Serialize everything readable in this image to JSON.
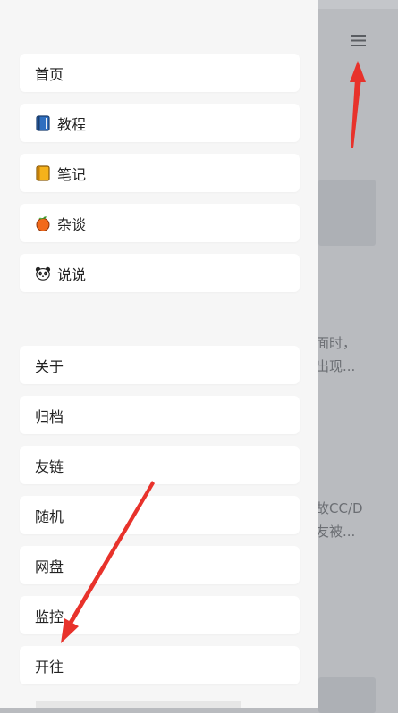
{
  "drawer": {
    "primary_items": [
      {
        "label": "首页",
        "icon": ""
      },
      {
        "label": "教程",
        "icon": "book-icon"
      },
      {
        "label": "笔记",
        "icon": "notebook-icon"
      },
      {
        "label": "杂谈",
        "icon": "tangerine-icon"
      },
      {
        "label": "说说",
        "icon": "panda-icon"
      }
    ],
    "secondary_items": [
      {
        "label": "关于"
      },
      {
        "label": "归档"
      },
      {
        "label": "友链"
      },
      {
        "label": "随机"
      },
      {
        "label": "网盘"
      },
      {
        "label": "监控"
      },
      {
        "label": "开往"
      }
    ]
  },
  "background": {
    "menu_icon": "hamburger-menu-icon",
    "snippet1": [
      "面时，",
      "出现..."
    ],
    "snippet2": [
      "故CC/D",
      "友被..."
    ]
  },
  "colors": {
    "drawer_bg": "#f6f6f6",
    "item_bg": "#ffffff",
    "overlay": "#b9bbbf",
    "annotation_arrow": "#e8322b"
  }
}
